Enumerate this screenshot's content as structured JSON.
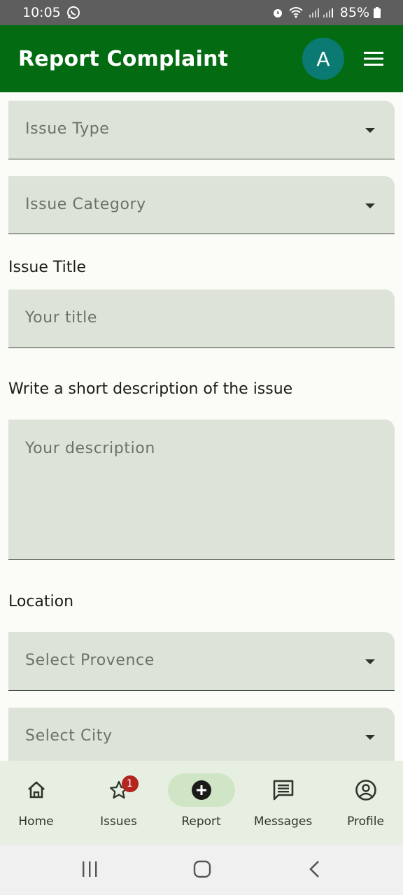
{
  "status_bar": {
    "time": "10:05",
    "battery": "85%",
    "icons": [
      "whatsapp-icon",
      "alarm-icon",
      "wifi-icon",
      "signal-icon",
      "battery-icon"
    ]
  },
  "app_bar": {
    "title": "Report Complaint",
    "avatar_initial": "A",
    "menu_icon": "hamburger-menu-icon",
    "colors": {
      "app_bar": "#036b12",
      "avatar": "#0b7a73"
    }
  },
  "form": {
    "issue_type": {
      "placeholder": "Issue Type"
    },
    "issue_category": {
      "placeholder": "Issue Category"
    },
    "title_section": {
      "label": "Issue Title",
      "placeholder": "Your title"
    },
    "description_section": {
      "label": "Write a short description of the issue",
      "placeholder": "Your description"
    },
    "location_section": {
      "label": "Location"
    },
    "province": {
      "placeholder": "Select Provence"
    },
    "city": {
      "placeholder": "Select City"
    }
  },
  "bottom_nav": {
    "items": [
      {
        "label": "Home",
        "icon": "home-icon"
      },
      {
        "label": "Issues",
        "icon": "star-icon",
        "badge": "1"
      },
      {
        "label": "Report",
        "icon": "add-circle-icon",
        "active": true
      },
      {
        "label": "Messages",
        "icon": "message-icon"
      },
      {
        "label": "Profile",
        "icon": "account-circle-icon"
      }
    ]
  },
  "system_nav": {
    "buttons": [
      "recents-icon",
      "home-button-icon",
      "back-icon"
    ]
  }
}
